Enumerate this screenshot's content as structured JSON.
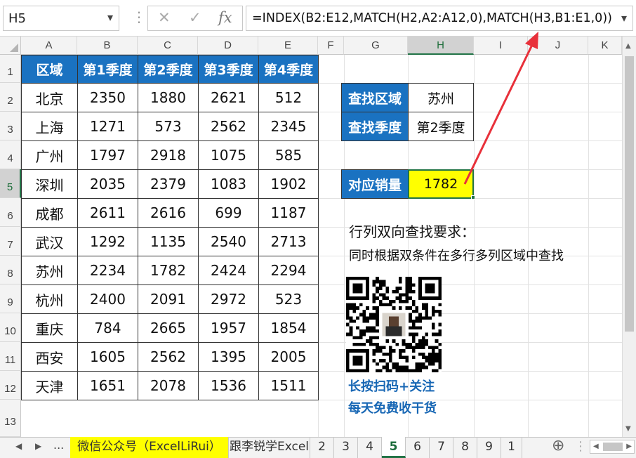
{
  "formula_bar": {
    "name_box": "H5",
    "cancel_glyph": "✕",
    "enter_glyph": "✓",
    "fx_glyph": "fx",
    "formula": "=INDEX(B2:E12,MATCH(H2,A2:A12,0),MATCH(H3,B1:E1,0))"
  },
  "columns": [
    "A",
    "B",
    "C",
    "D",
    "E",
    "F",
    "G",
    "H",
    "I",
    "J",
    "K"
  ],
  "selected_column": "H",
  "rows": [
    "1",
    "2",
    "3",
    "4",
    "5",
    "6",
    "7",
    "8",
    "9",
    "10",
    "11",
    "12",
    "13"
  ],
  "selected_row": "5",
  "table": {
    "headers": [
      "区域",
      "第1季度",
      "第2季度",
      "第3季度",
      "第4季度"
    ],
    "rows": [
      [
        "北京",
        "2350",
        "1880",
        "2621",
        "512"
      ],
      [
        "上海",
        "1271",
        "573",
        "2562",
        "2345"
      ],
      [
        "广州",
        "1797",
        "2918",
        "1075",
        "585"
      ],
      [
        "深圳",
        "2035",
        "2379",
        "1083",
        "1902"
      ],
      [
        "成都",
        "2611",
        "2616",
        "699",
        "1187"
      ],
      [
        "武汉",
        "1292",
        "1135",
        "2540",
        "2713"
      ],
      [
        "苏州",
        "2234",
        "1782",
        "2424",
        "2294"
      ],
      [
        "杭州",
        "2400",
        "2091",
        "2972",
        "523"
      ],
      [
        "重庆",
        "784",
        "2665",
        "1957",
        "1854"
      ],
      [
        "西安",
        "1605",
        "2562",
        "1395",
        "2005"
      ],
      [
        "天津",
        "1651",
        "2078",
        "1536",
        "1511"
      ]
    ]
  },
  "lookup": {
    "region_label": "查找区域",
    "region_value": "苏州",
    "quarter_label": "查找季度",
    "quarter_value": "第2季度",
    "result_label": "对应销量",
    "result_value": "1782"
  },
  "notes": {
    "title": "行列双向查找要求：",
    "desc": "同时根据双条件在多行多列区域中查找",
    "cta1": "长按扫码+关注",
    "cta2": "每天免费收干货"
  },
  "colors": {
    "header_blue": "#1a72c1",
    "result_yellow": "#ffff00",
    "arrow_red": "#e8303a",
    "excel_green": "#217346"
  },
  "sheet_tabs": {
    "ellipsis": "...",
    "tabs": [
      "微信公众号（ExcelLiRui）",
      "跟李锐学Excel",
      "2",
      "3",
      "4",
      "5",
      "6",
      "7",
      "8",
      "9",
      "1"
    ],
    "active": "5",
    "add_glyph": "⊕"
  }
}
